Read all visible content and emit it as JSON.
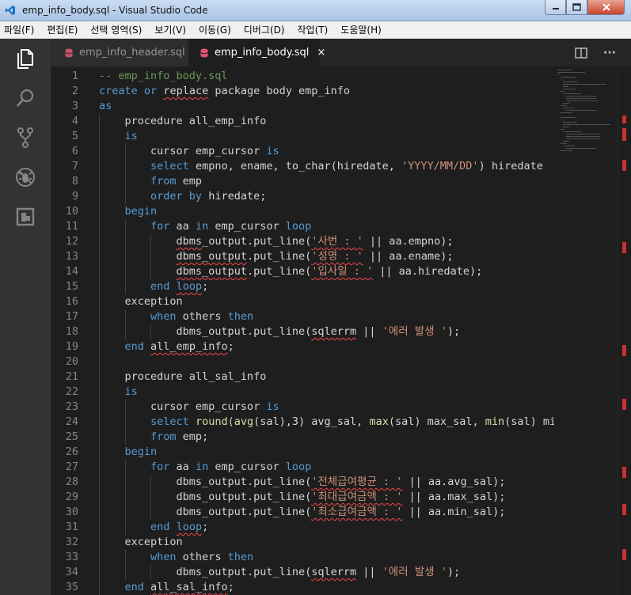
{
  "window": {
    "title": "emp_info_body.sql - Visual Studio Code",
    "icon": "vscode-icon"
  },
  "menu": [
    "파일(F)",
    "편집(E)",
    "선택 영역(S)",
    "보기(V)",
    "이동(G)",
    "디버그(D)",
    "작업(T)",
    "도움말(H)"
  ],
  "activity_bar": [
    "explorer-icon",
    "search-icon",
    "source-control-icon",
    "debug-icon",
    "extensions-icon"
  ],
  "tabs": [
    {
      "label": "emp_info_header.sql",
      "active": false,
      "icon": "database-icon"
    },
    {
      "label": "emp_info_body.sql",
      "active": true,
      "icon": "database-icon",
      "close": "×"
    }
  ],
  "editor_actions": {
    "split": "split-editor-icon",
    "more": "···"
  },
  "colors": {
    "keyword": "#569cd6",
    "comment": "#6a9955",
    "string": "#ce9178",
    "error": "#f44747",
    "accent": "#007acc"
  },
  "code": [
    {
      "n": "1",
      "s": [
        [
          "-- emp_info_body.sql",
          "cm"
        ]
      ]
    },
    {
      "n": "2",
      "s": [
        [
          "create",
          "kw"
        ],
        [
          " ",
          ""
        ],
        [
          "or",
          "kw"
        ],
        [
          " ",
          ""
        ],
        [
          "replace",
          "sq"
        ],
        [
          " package body emp_info",
          ""
        ]
      ]
    },
    {
      "n": "3",
      "s": [
        [
          "as",
          "kw"
        ]
      ]
    },
    {
      "n": "4",
      "s": [
        [
          "    procedure all_emp_info",
          ""
        ]
      ]
    },
    {
      "n": "5",
      "s": [
        [
          "    ",
          ""
        ],
        [
          "is",
          "kw"
        ]
      ]
    },
    {
      "n": "6",
      "s": [
        [
          "        cursor emp_cursor ",
          ""
        ],
        [
          "is",
          "kw"
        ]
      ]
    },
    {
      "n": "7",
      "s": [
        [
          "        ",
          ""
        ],
        [
          "select",
          "kw"
        ],
        [
          " empno, ename, to_char(hiredate, ",
          ""
        ],
        [
          "'YYYY/MM/DD'",
          "st"
        ],
        [
          ") hiredate",
          ""
        ]
      ]
    },
    {
      "n": "8",
      "s": [
        [
          "        ",
          ""
        ],
        [
          "from",
          "kw"
        ],
        [
          " emp",
          ""
        ]
      ]
    },
    {
      "n": "9",
      "s": [
        [
          "        ",
          ""
        ],
        [
          "order by",
          "kw"
        ],
        [
          " hiredate;",
          ""
        ]
      ]
    },
    {
      "n": "10",
      "s": [
        [
          "    ",
          ""
        ],
        [
          "begin",
          "kw"
        ]
      ]
    },
    {
      "n": "11",
      "s": [
        [
          "        ",
          ""
        ],
        [
          "for",
          "kw"
        ],
        [
          " aa ",
          ""
        ],
        [
          "in",
          "kw"
        ],
        [
          " emp_cursor ",
          ""
        ],
        [
          "loop",
          "kw"
        ]
      ]
    },
    {
      "n": "12",
      "s": [
        [
          "            ",
          ""
        ],
        [
          "dbms",
          "sq"
        ],
        [
          "_output.put_line(",
          ""
        ],
        [
          "'사번 : '",
          "st sq"
        ],
        [
          " || aa.empno);",
          ""
        ]
      ]
    },
    {
      "n": "13",
      "s": [
        [
          "            ",
          ""
        ],
        [
          "dbms_output",
          "sq"
        ],
        [
          ".put_line(",
          ""
        ],
        [
          "'성명 : '",
          "st sq"
        ],
        [
          " || aa.ename);",
          ""
        ]
      ]
    },
    {
      "n": "14",
      "s": [
        [
          "            ",
          ""
        ],
        [
          "dbms_output",
          "sq"
        ],
        [
          ".put_line(",
          ""
        ],
        [
          "'입사일 : '",
          "st sq"
        ],
        [
          " || aa.hiredate);",
          ""
        ]
      ]
    },
    {
      "n": "15",
      "s": [
        [
          "        ",
          ""
        ],
        [
          "end",
          "kw"
        ],
        [
          " ",
          ""
        ],
        [
          "loop",
          "kw sq"
        ],
        [
          ";",
          ""
        ]
      ]
    },
    {
      "n": "16",
      "s": [
        [
          "    exception",
          ""
        ]
      ]
    },
    {
      "n": "17",
      "s": [
        [
          "        ",
          ""
        ],
        [
          "when",
          "kw"
        ],
        [
          " others ",
          ""
        ],
        [
          "then",
          "kw"
        ]
      ]
    },
    {
      "n": "18",
      "s": [
        [
          "            dbms_output.put_line(",
          ""
        ],
        [
          "sqlerrm",
          "sq"
        ],
        [
          " || ",
          ""
        ],
        [
          "'에러 발생 '",
          "st"
        ],
        [
          ");",
          ""
        ]
      ]
    },
    {
      "n": "19",
      "s": [
        [
          "    ",
          ""
        ],
        [
          "end",
          "kw"
        ],
        [
          " ",
          ""
        ],
        [
          "all_emp_info",
          "sq"
        ],
        [
          ";",
          ""
        ]
      ]
    },
    {
      "n": "20",
      "s": []
    },
    {
      "n": "21",
      "s": [
        [
          "    procedure all_sal_info",
          ""
        ]
      ]
    },
    {
      "n": "22",
      "s": [
        [
          "    ",
          ""
        ],
        [
          "is",
          "kw"
        ]
      ]
    },
    {
      "n": "23",
      "s": [
        [
          "        cursor emp_cursor ",
          ""
        ],
        [
          "is",
          "kw"
        ]
      ]
    },
    {
      "n": "24",
      "s": [
        [
          "        ",
          ""
        ],
        [
          "select",
          "kw"
        ],
        [
          " ",
          ""
        ],
        [
          "round",
          "fn"
        ],
        [
          "(",
          ""
        ],
        [
          "avg",
          "fn"
        ],
        [
          "(sal),3) avg_sal, ",
          ""
        ],
        [
          "max",
          "fn"
        ],
        [
          "(sal) max_sal, ",
          ""
        ],
        [
          "min",
          "fn"
        ],
        [
          "(sal) min_sa",
          ""
        ]
      ]
    },
    {
      "n": "25",
      "s": [
        [
          "        ",
          ""
        ],
        [
          "from",
          "kw"
        ],
        [
          " emp;",
          ""
        ]
      ]
    },
    {
      "n": "26",
      "s": [
        [
          "    ",
          ""
        ],
        [
          "begin",
          "kw"
        ]
      ]
    },
    {
      "n": "27",
      "s": [
        [
          "        ",
          ""
        ],
        [
          "for",
          "kw"
        ],
        [
          " aa ",
          ""
        ],
        [
          "in",
          "kw"
        ],
        [
          " emp_cursor ",
          ""
        ],
        [
          "loop",
          "kw"
        ]
      ]
    },
    {
      "n": "28",
      "s": [
        [
          "            dbms_output.put_line(",
          ""
        ],
        [
          "'전체급여평균 : '",
          "st sq"
        ],
        [
          " || aa.avg_sal);",
          ""
        ]
      ]
    },
    {
      "n": "29",
      "s": [
        [
          "            dbms_output.put_line(",
          ""
        ],
        [
          "'최대급여금액 : '",
          "st sq"
        ],
        [
          " || aa.max_sal);",
          ""
        ]
      ]
    },
    {
      "n": "30",
      "s": [
        [
          "            dbms_output.put_line(",
          ""
        ],
        [
          "'최소급여금액 : '",
          "st sq"
        ],
        [
          " || aa.min_sal);",
          ""
        ]
      ]
    },
    {
      "n": "31",
      "s": [
        [
          "        ",
          ""
        ],
        [
          "end",
          "kw"
        ],
        [
          " ",
          ""
        ],
        [
          "loop",
          "kw sq"
        ],
        [
          ";",
          ""
        ]
      ]
    },
    {
      "n": "32",
      "s": [
        [
          "    exception",
          ""
        ]
      ]
    },
    {
      "n": "33",
      "s": [
        [
          "        ",
          ""
        ],
        [
          "when",
          "kw"
        ],
        [
          " others ",
          ""
        ],
        [
          "then",
          "kw"
        ]
      ]
    },
    {
      "n": "34",
      "s": [
        [
          "            dbms_output.put_line(",
          ""
        ],
        [
          "sqlerrm",
          "sq"
        ],
        [
          " || ",
          ""
        ],
        [
          "'에러 발생 '",
          "st"
        ],
        [
          ");",
          ""
        ]
      ]
    },
    {
      "n": "35",
      "s": [
        [
          "    ",
          ""
        ],
        [
          "end",
          "kw"
        ],
        [
          " ",
          ""
        ],
        [
          "all_sal_info",
          "sq"
        ],
        [
          ";",
          ""
        ]
      ]
    }
  ]
}
